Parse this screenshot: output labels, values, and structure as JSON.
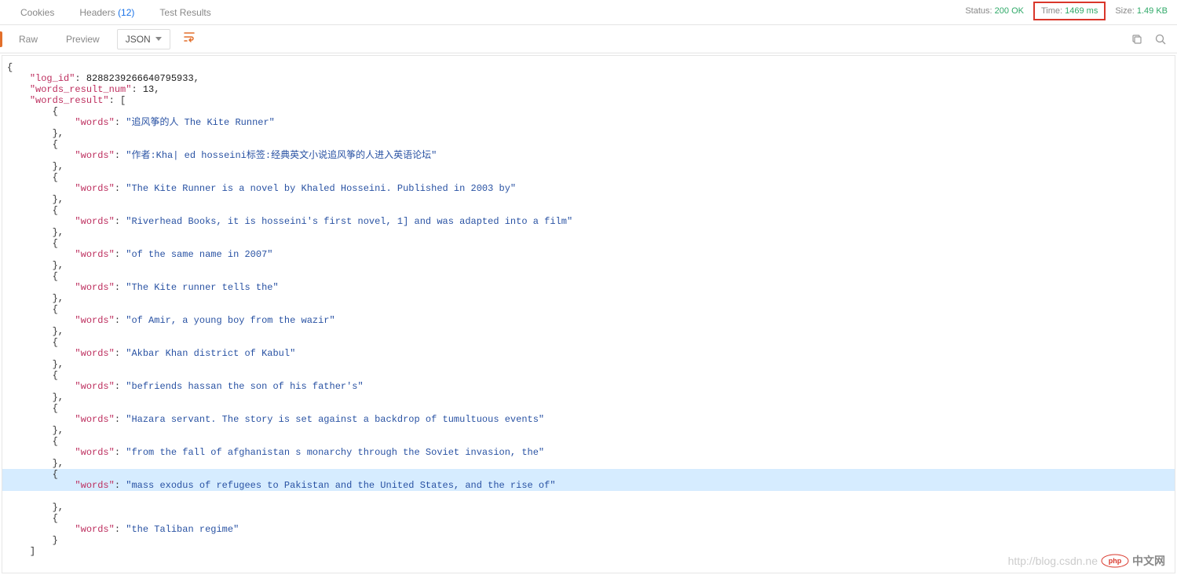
{
  "tabs": {
    "cookies": "Cookies",
    "headers": "Headers",
    "headers_count": "(12)",
    "test_results": "Test Results"
  },
  "status": {
    "status_label": "Status:",
    "status_value": "200 OK",
    "time_label": "Time:",
    "time_value": "1469 ms",
    "size_label": "Size:",
    "size_value": "1.49 KB"
  },
  "toolbar": {
    "raw": "Raw",
    "preview": "Preview",
    "json": "JSON"
  },
  "json": {
    "log_id_key": "\"log_id\"",
    "log_id_val": "8288239266640795933",
    "num_key": "\"words_result_num\"",
    "num_val": "13",
    "result_key": "\"words_result\"",
    "word_key": "\"words\"",
    "items": [
      "\"追风筝的人 The Kite Runner\"",
      "\"作者:Kha| ed hosseini标签:经典英文小说追风筝的人进入英语论坛\"",
      "\"The Kite Runner is a novel by Khaled Hosseini. Published in 2003 by\"",
      "\"Riverhead Books, it is hosseini's first novel, 1] and was adapted into a film\"",
      "\"of the same name in 2007\"",
      "\"The Kite runner tells the\"",
      "\"of Amir, a young boy from the wazir\"",
      "\"Akbar Khan district of Kabul\"",
      "\"befriends hassan the son of his father's\"",
      "\"Hazara servant. The story is set against a backdrop of tumultuous events\"",
      "\"from the fall of afghanistan s monarchy through the Soviet invasion, the\"",
      "\"mass exodus of refugees to Pakistan and the United States, and the rise of\"",
      "\"the Taliban regime\""
    ]
  },
  "watermark": {
    "url": "http://blog.csdn.ne",
    "cn_text": "中文网"
  }
}
